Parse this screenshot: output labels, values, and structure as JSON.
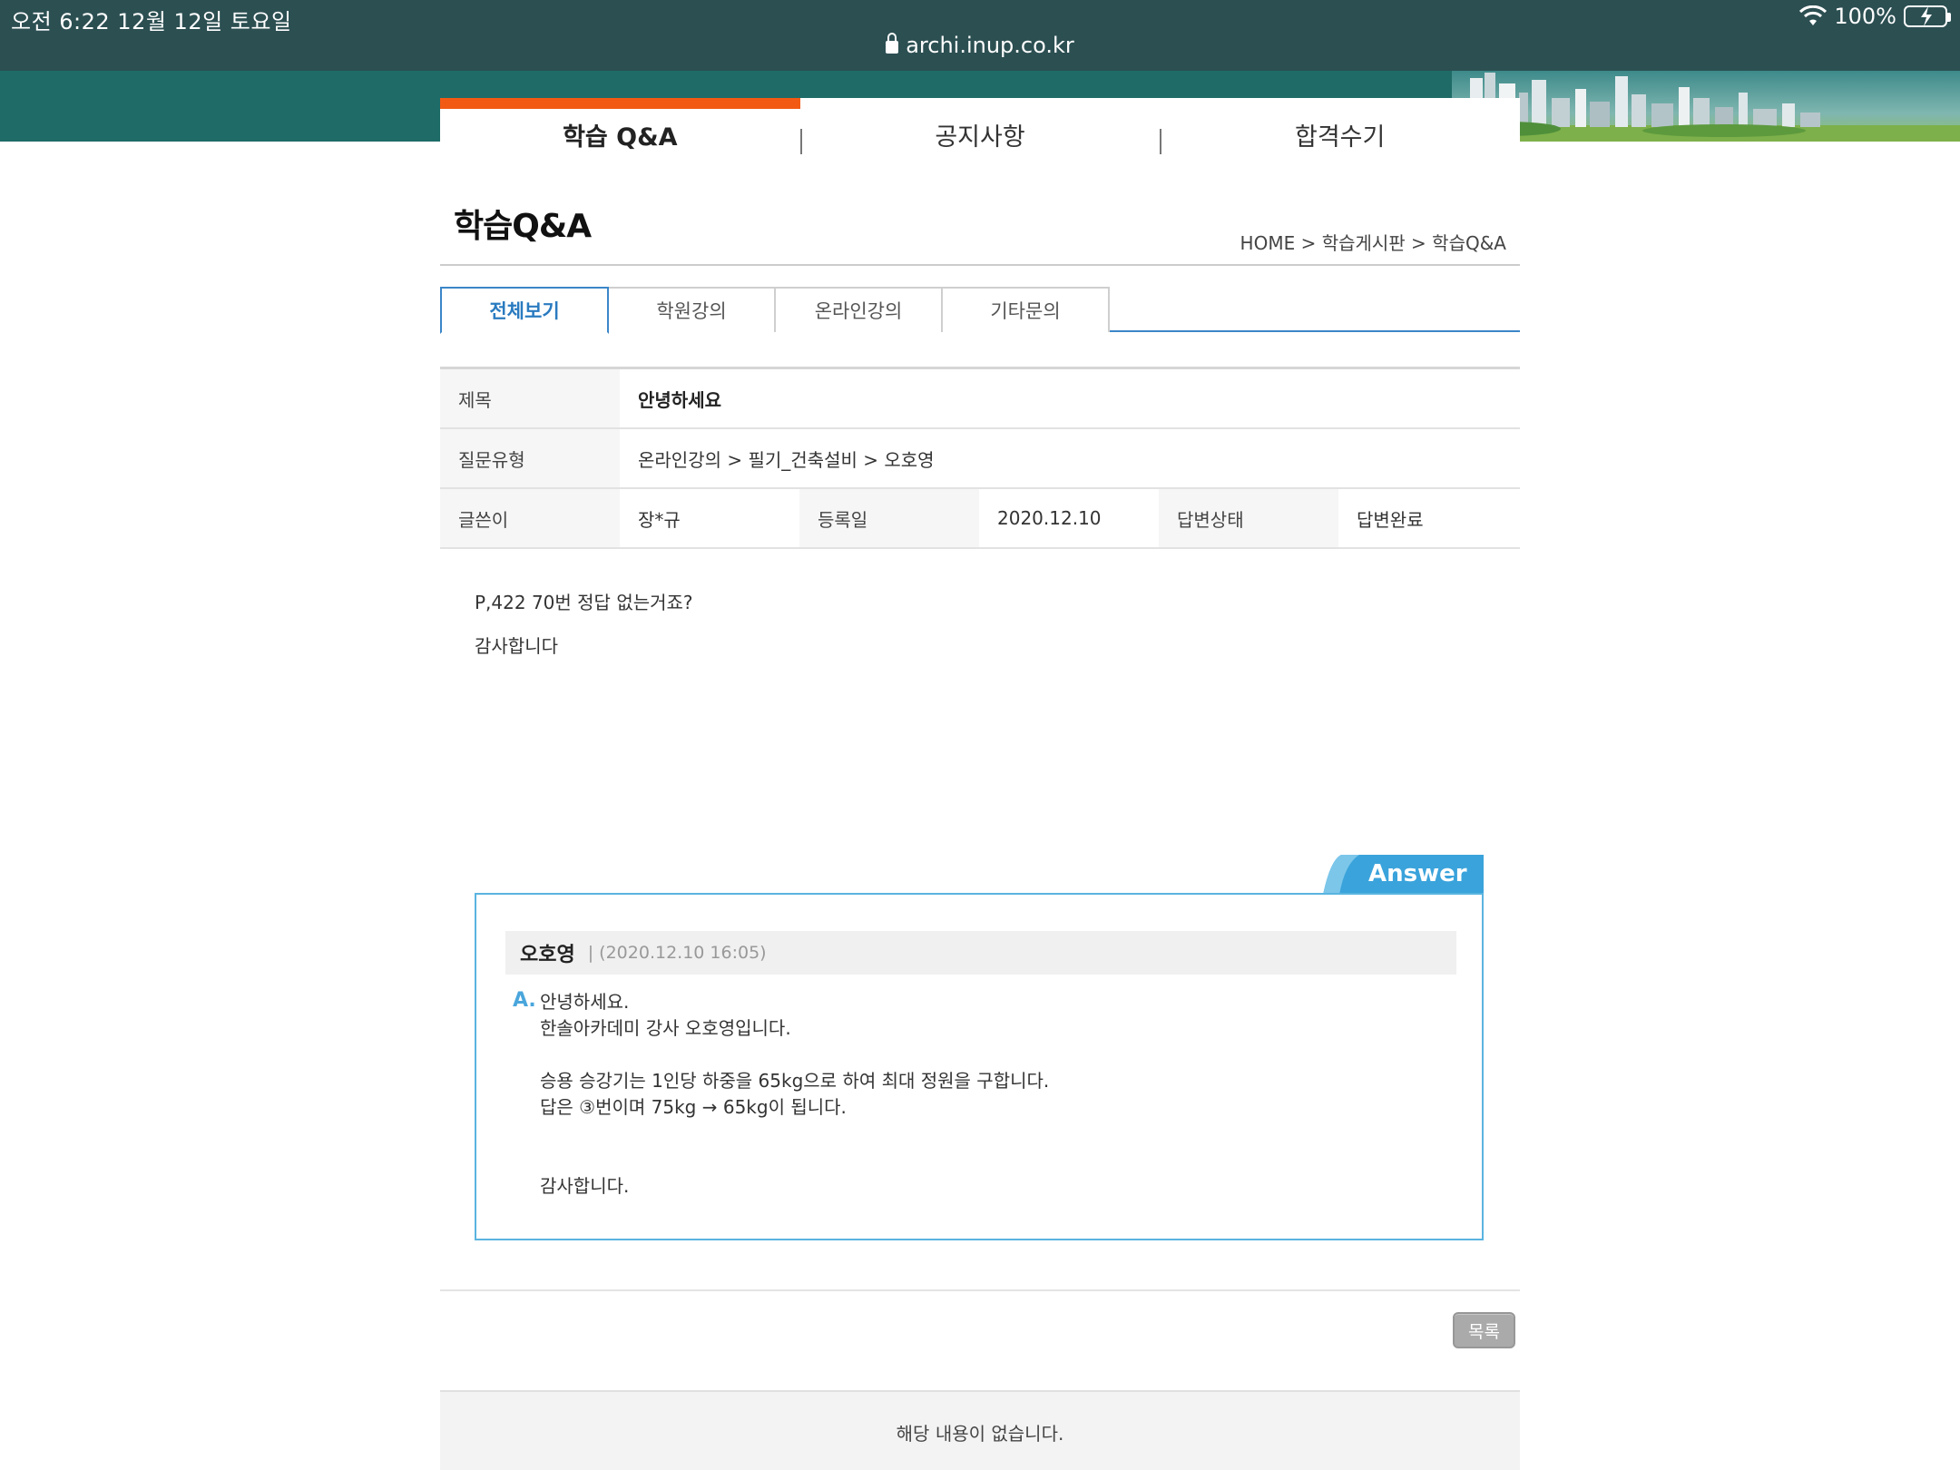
{
  "status_bar": {
    "time": "오전 6:22   12월 12일 토요일",
    "battery": "100%",
    "url": "archi.inup.co.kr"
  },
  "top_nav": {
    "items": [
      {
        "label": "학습 Q&A",
        "active": true
      },
      {
        "label": "공지사항",
        "active": false
      },
      {
        "label": "합격수기",
        "active": false
      }
    ]
  },
  "page": {
    "title": "학습Q&A",
    "breadcrumb": "HOME > 학습게시판 > 학습Q&A"
  },
  "sub_tabs": [
    {
      "label": "전체보기",
      "active": true
    },
    {
      "label": "학원강의",
      "active": false
    },
    {
      "label": "온라인강의",
      "active": false
    },
    {
      "label": "기타문의",
      "active": false
    }
  ],
  "info": {
    "subject_label": "제목",
    "subject_value": "안녕하세요",
    "type_label": "질문유형",
    "type_value": "온라인강의 > 필기_건축설비 > 오호영",
    "writer_label": "글쓴이",
    "writer_value": "장*규",
    "date_label": "등록일",
    "date_value": "2020.12.10",
    "status_label": "답변상태",
    "status_value": "답변완료"
  },
  "question": {
    "lines": [
      "P,422 70번 정답 없는거죠?",
      "감사합니다"
    ]
  },
  "answer": {
    "tab_label": "Answer",
    "author": "오호영",
    "date": "| (2020.12.10 16:05)",
    "mark": "A.",
    "lines": [
      "안녕하세요.",
      "한솔아카데미 강사 오호영입니다.",
      "",
      "승용 승강기는 1인당 하중을 65kg으로 하여 최대 정원을 구합니다.",
      "답은 ③번이며 75kg → 65kg이 됩니다.",
      "",
      "",
      "감사합니다."
    ]
  },
  "buttons": {
    "list_label": "목록"
  },
  "empty_message": "해당 내용이 없습니다.",
  "colors": {
    "accent_orange": "#f25a14",
    "tab_blue": "#3b86c8",
    "answer_blue": "#4aa6dc",
    "header_teal": "#1e6b67"
  }
}
